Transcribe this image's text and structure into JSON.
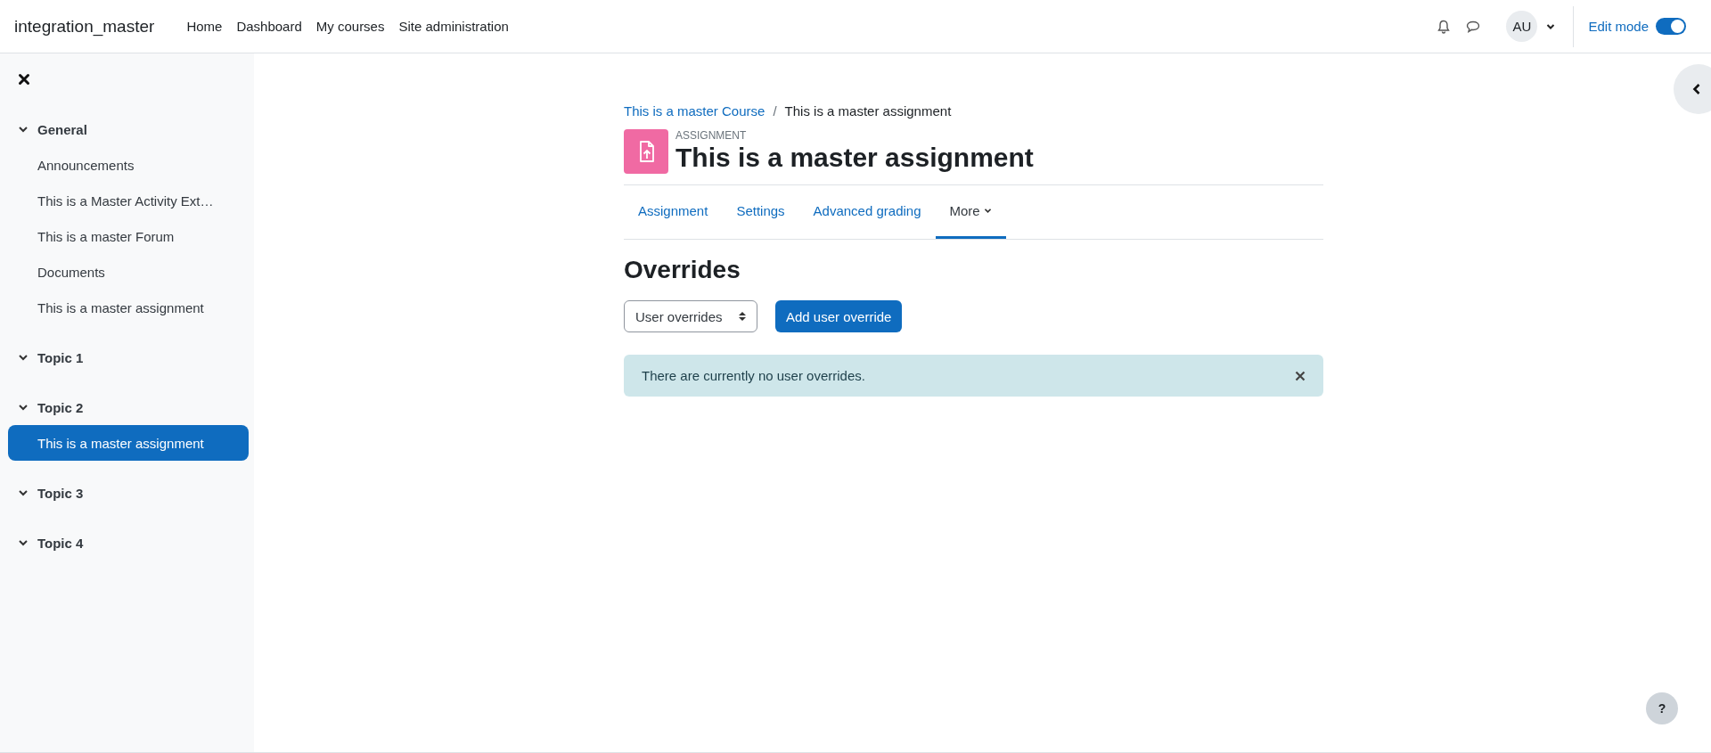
{
  "navbar": {
    "site_name": "integration_master",
    "links": [
      {
        "label": "Home"
      },
      {
        "label": "Dashboard"
      },
      {
        "label": "My courses"
      },
      {
        "label": "Site administration"
      }
    ],
    "avatar": "AU",
    "edit_mode": {
      "label": "Edit mode",
      "on": true
    }
  },
  "sidebar": {
    "sections": [
      {
        "label": "General",
        "expanded": true,
        "children": [
          {
            "label": "Announcements",
            "selected": false
          },
          {
            "label": "This is a Master Activity Ext…",
            "selected": false
          },
          {
            "label": "This is a master Forum",
            "selected": false
          },
          {
            "label": "Documents",
            "selected": false
          },
          {
            "label": "This is a master assignment",
            "selected": false
          }
        ]
      },
      {
        "label": "Topic 1",
        "expanded": true
      },
      {
        "label": "Topic 2",
        "expanded": true,
        "children": [
          {
            "label": "This is a master assignment",
            "selected": true
          }
        ]
      },
      {
        "label": "Topic 3",
        "expanded": true
      },
      {
        "label": "Topic 4",
        "expanded": true
      }
    ]
  },
  "breadcrumb": [
    {
      "label": "This is a master Course",
      "kind": "link"
    },
    {
      "label": "This is a master assignment",
      "kind": "current"
    }
  ],
  "breadcrumb_separator": "/",
  "activity": {
    "type_label": "ASSIGNMENT",
    "title": "This is a master assignment"
  },
  "tabs": [
    {
      "label": "Assignment",
      "selected": false
    },
    {
      "label": "Settings",
      "selected": false
    },
    {
      "label": "Advanced grading",
      "selected": false
    },
    {
      "label": "More",
      "selected": true
    }
  ],
  "page_heading": "Overrides",
  "override_select": {
    "value": "User overrides"
  },
  "add_button": "Add user override",
  "alert": {
    "text": "There are currently no user overrides."
  },
  "help_label": "?"
}
